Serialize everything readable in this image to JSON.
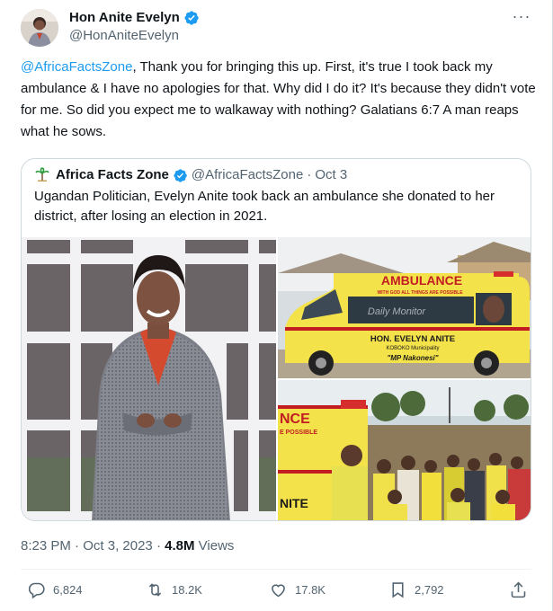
{
  "author": {
    "display_name": "Hon Anite Evelyn",
    "handle": "@HonAniteEvelyn",
    "verified": true,
    "avatar_icon": "profile-photo"
  },
  "more_icon": "ellipsis-icon",
  "tweet": {
    "mention": "@AfricaFactsZone",
    "text": ", Thank you for bringing this up. First, it's true I took back my ambulance & I have no apologies for that. Why did I do it? It's because they didn't vote for me. So did you expect me to walkaway with nothing? Galatians 6:7 A man reaps what he sows."
  },
  "quoted": {
    "display_name": "Africa Facts Zone",
    "handle": "@AfricaFactsZone",
    "separator": "·",
    "date": "Oct 3",
    "text": "Ugandan Politician, Evelyn Anite took back an ambulance she donated to her district, after losing an election in 2021.",
    "images": {
      "left": "photo-woman-grey-blazer",
      "right_top": "photo-ambulance-van",
      "right_bottom": "photo-crowd-at-ambulance"
    },
    "ambulance_text": {
      "banner": "AMBULANCE",
      "slogan": "WITH GOD ALL THINGS ARE POSSIBLE",
      "watermark": "Daily Monitor",
      "owner": "HON. EVELYN ANITE",
      "municipality": "KOBOKO Municipality",
      "nickname": "\"MP Nakonesi\"",
      "crop_banner": "NCE",
      "crop_slogan": "E POSSIBLE",
      "crop_side": "NITE"
    }
  },
  "meta": {
    "time": "8:23 PM",
    "sep": "·",
    "date": "Oct 3, 2023",
    "sep2": "·",
    "views_count": "4.8M",
    "views_label": "Views"
  },
  "actions": {
    "replies": "6,824",
    "retweets": "18.2K",
    "likes": "17.8K",
    "bookmarks": "2,792"
  },
  "colors": {
    "accent": "#1d9bf0",
    "text": "#0f1419",
    "secondary": "#536471",
    "border": "#cfd9de"
  }
}
